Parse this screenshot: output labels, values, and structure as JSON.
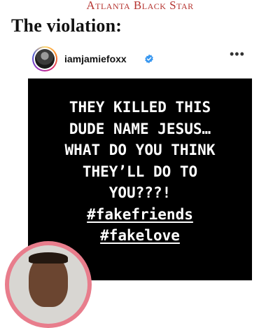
{
  "brand": {
    "name": "Atlanta Black Star"
  },
  "article": {
    "headline": "The violation:"
  },
  "post": {
    "username": "iamjamiefoxx",
    "verified": true,
    "more_icon": "more-horizontal-icon",
    "story_lines": [
      "THEY KILLED THIS",
      "DUDE NAME JESUS…",
      "WHAT DO YOU THINK",
      "THEY’LL DO TO",
      "YOU???!"
    ],
    "hashtags": [
      "#fakefriends",
      "#fakelove"
    ]
  },
  "colors": {
    "brand": "#b5332f",
    "story_background": "#000000",
    "verified": "#3897f0",
    "inset_border": "#e87d8c"
  }
}
